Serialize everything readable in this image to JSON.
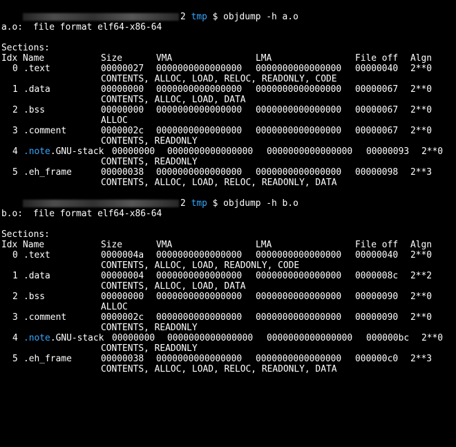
{
  "prompts": [
    {
      "host_suffix": "2",
      "dir": "tmp",
      "symbol": "$",
      "command": "objdump -h a.o"
    },
    {
      "host_suffix": "2",
      "dir": "tmp",
      "symbol": "$",
      "command": "objdump -h b.o"
    }
  ],
  "colors": {
    "background": "#000000",
    "text": "#ffffff",
    "accent": "#35a7ff"
  },
  "headers": {
    "idx_name": "Idx Name",
    "size": "Size",
    "vma": "VMA",
    "lma": "LMA",
    "fileoff": "File off",
    "algn": "Algn",
    "sections": "Sections:"
  },
  "dumps": [
    {
      "file_label": "a.o:",
      "format": "file format elf64-x86-64",
      "sections": [
        {
          "idx": "0",
          "name": ".text",
          "size": "00000027",
          "vma": "0000000000000000",
          "lma": "0000000000000000",
          "fileoff": "00000040",
          "algn": "2**0",
          "flags": "CONTENTS, ALLOC, LOAD, RELOC, READONLY, CODE"
        },
        {
          "idx": "1",
          "name": ".data",
          "size": "00000000",
          "vma": "0000000000000000",
          "lma": "0000000000000000",
          "fileoff": "00000067",
          "algn": "2**0",
          "flags": "CONTENTS, ALLOC, LOAD, DATA"
        },
        {
          "idx": "2",
          "name": ".bss",
          "size": "00000000",
          "vma": "0000000000000000",
          "lma": "0000000000000000",
          "fileoff": "00000067",
          "algn": "2**0",
          "flags": "ALLOC"
        },
        {
          "idx": "3",
          "name": ".comment",
          "size": "0000002c",
          "vma": "0000000000000000",
          "lma": "0000000000000000",
          "fileoff": "00000067",
          "algn": "2**0",
          "flags": "CONTENTS, READONLY"
        },
        {
          "idx": "4",
          "name_hl": ".note",
          "name_rest": ".GNU-stack",
          "size": "00000000",
          "vma": "0000000000000000",
          "lma": "0000000000000000",
          "fileoff": "00000093",
          "algn": "2**0",
          "flags": "CONTENTS, READONLY"
        },
        {
          "idx": "5",
          "name": ".eh_frame",
          "size": "00000038",
          "vma": "0000000000000000",
          "lma": "0000000000000000",
          "fileoff": "00000098",
          "algn": "2**3",
          "flags": "CONTENTS, ALLOC, LOAD, RELOC, READONLY, DATA"
        }
      ]
    },
    {
      "file_label": "b.o:",
      "format": "file format elf64-x86-64",
      "sections": [
        {
          "idx": "0",
          "name": ".text",
          "size": "0000004a",
          "vma": "0000000000000000",
          "lma": "0000000000000000",
          "fileoff": "00000040",
          "algn": "2**0",
          "flags": "CONTENTS, ALLOC, LOAD, READONLY, CODE"
        },
        {
          "idx": "1",
          "name": ".data",
          "size": "00000004",
          "vma": "0000000000000000",
          "lma": "0000000000000000",
          "fileoff": "0000008c",
          "algn": "2**2",
          "flags": "CONTENTS, ALLOC, LOAD, DATA"
        },
        {
          "idx": "2",
          "name": ".bss",
          "size": "00000000",
          "vma": "0000000000000000",
          "lma": "0000000000000000",
          "fileoff": "00000090",
          "algn": "2**0",
          "flags": "ALLOC"
        },
        {
          "idx": "3",
          "name": ".comment",
          "size": "0000002c",
          "vma": "0000000000000000",
          "lma": "0000000000000000",
          "fileoff": "00000090",
          "algn": "2**0",
          "flags": "CONTENTS, READONLY"
        },
        {
          "idx": "4",
          "name_hl": ".note",
          "name_rest": ".GNU-stack",
          "size": "00000000",
          "vma": "0000000000000000",
          "lma": "0000000000000000",
          "fileoff": "000000bc",
          "algn": "2**0",
          "flags": "CONTENTS, READONLY"
        },
        {
          "idx": "5",
          "name": ".eh_frame",
          "size": "00000038",
          "vma": "0000000000000000",
          "lma": "0000000000000000",
          "fileoff": "000000c0",
          "algn": "2**3",
          "flags": "CONTENTS, ALLOC, LOAD, RELOC, READONLY, DATA"
        }
      ]
    }
  ]
}
